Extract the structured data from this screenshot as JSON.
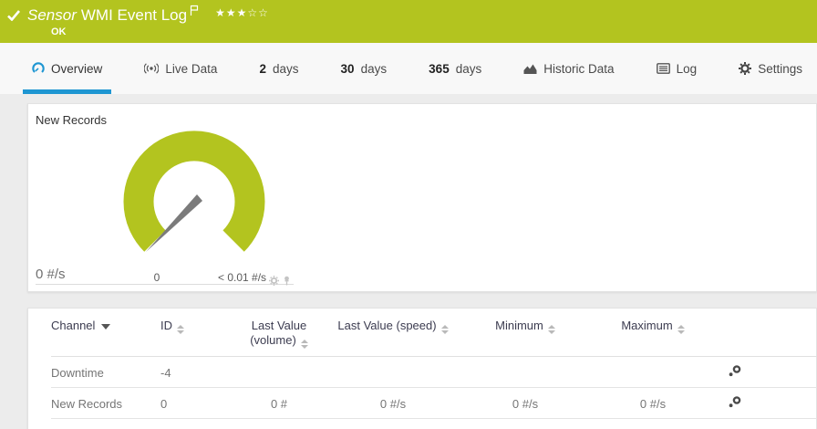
{
  "header": {
    "kicker": "Sensor",
    "title": "WMI Event Log",
    "status": "OK",
    "stars_filled": "★★★",
    "stars_empty": "☆☆"
  },
  "tabs": [
    {
      "label": "Overview"
    },
    {
      "label": "Live Data"
    },
    {
      "num": "2",
      "label": "days"
    },
    {
      "num": "30",
      "label": "days"
    },
    {
      "num": "365",
      "label": "days"
    },
    {
      "label": "Historic Data"
    },
    {
      "label": "Log"
    },
    {
      "label": "Settings"
    }
  ],
  "gauge_panel": {
    "title": "New Records",
    "current_value_label": "0 #/s",
    "scale_min_label": "0",
    "scale_max_label": "< 0.01 #/s",
    "value": 0,
    "unit": "#/s",
    "gauge_color": "#b3c41f"
  },
  "colors": {
    "banner_green": "#b3c41f",
    "accent_blue": "#1e96d2"
  },
  "table": {
    "headers": [
      "Channel",
      "ID",
      "Last Value (volume)",
      "Last Value (speed)",
      "Minimum",
      "Maximum"
    ],
    "rows": [
      {
        "channel": "Downtime",
        "id": "-4",
        "last_value_volume": "",
        "last_value_speed": "",
        "minimum": "",
        "maximum": ""
      },
      {
        "channel": "New Records",
        "id": "0",
        "last_value_volume": "0 #",
        "last_value_speed": "0 #/s",
        "minimum": "0 #/s",
        "maximum": "0 #/s"
      }
    ]
  }
}
